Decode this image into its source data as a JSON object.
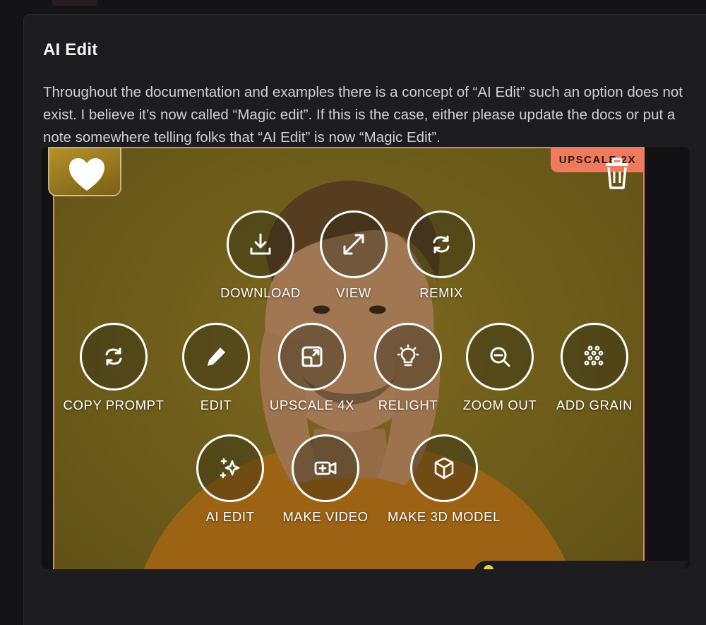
{
  "post": {
    "title": "AI Edit",
    "body": "Throughout the documentation and examples there is a concept of “AI Edit” such an option does not exist.  I believe it’s now called “Magic edit”.  If this is the case, either please update the docs or put a note somewhere telling folks that “AI Edit” is now “Magic Edit”."
  },
  "screenshot": {
    "badge": "UPSCALE 2X",
    "actions": [
      {
        "label": "DOWNLOAD",
        "icon": "download-icon"
      },
      {
        "label": "VIEW",
        "icon": "expand-icon"
      },
      {
        "label": "REMIX",
        "icon": "refresh-icon"
      },
      {
        "label": "COPY PROMPT",
        "icon": "refresh-icon"
      },
      {
        "label": "EDIT",
        "icon": "pencil-icon"
      },
      {
        "label": "UPSCALE 4X",
        "icon": "upscale-icon"
      },
      {
        "label": "RELIGHT",
        "icon": "lightbulb-icon"
      },
      {
        "label": "ZOOM OUT",
        "icon": "zoom-out-icon"
      },
      {
        "label": "ADD GRAIN",
        "icon": "grain-icon"
      },
      {
        "label": "AI EDIT",
        "icon": "sparkle-icon"
      },
      {
        "label": "MAKE VIDEO",
        "icon": "video-icon"
      },
      {
        "label": "MAKE 3D MODEL",
        "icon": "cube-icon"
      }
    ],
    "colors": {
      "accent": "#f07a5d",
      "background": "#8a7420"
    }
  }
}
